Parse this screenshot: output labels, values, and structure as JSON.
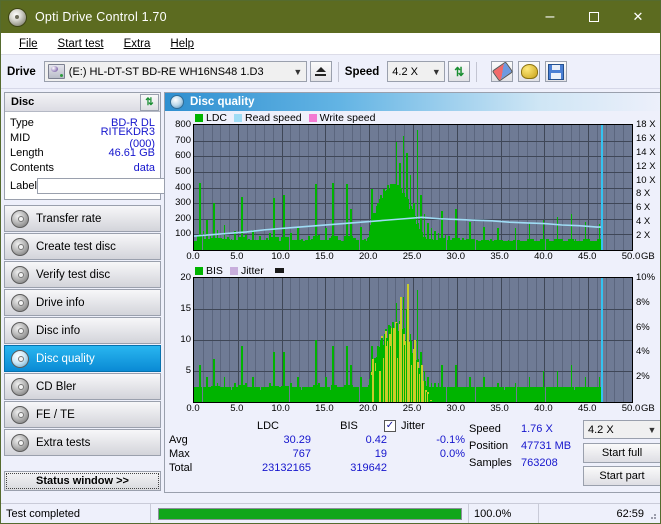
{
  "window": {
    "title": "Opti Drive Control 1.70",
    "icon": "disc-icon",
    "minimize": "–",
    "maximize": "square",
    "close": "✕"
  },
  "menu": [
    "File",
    "Start test",
    "Extra",
    "Help"
  ],
  "toolbar": {
    "drive_label": "Drive",
    "drive_value": "(E:)   HL-DT-ST BD-RE  WH16NS48 1.D3",
    "eject_title": "eject-button",
    "speed_label": "Speed",
    "speed_value": "4.2 X",
    "refresh_icon": "refresh-icon",
    "eraser_icon": "eraser-icon",
    "tools_icon": "tools-icon",
    "save_icon": "save-icon"
  },
  "disc": {
    "header": "Disc",
    "refresh_icon": "refresh-icon",
    "rows": [
      {
        "key": "Type",
        "value": "BD-R DL"
      },
      {
        "key": "MID",
        "value": "RITEKDR3 (000)"
      },
      {
        "key": "Length",
        "value": "46.61 GB"
      },
      {
        "key": "Contents",
        "value": "data"
      }
    ],
    "label_key": "Label",
    "label_value": "",
    "label_placeholder": ""
  },
  "nav": {
    "items": [
      {
        "label": "Transfer rate",
        "active": false
      },
      {
        "label": "Create test disc",
        "active": false
      },
      {
        "label": "Verify test disc",
        "active": false
      },
      {
        "label": "Drive info",
        "active": false
      },
      {
        "label": "Disc info",
        "active": false
      },
      {
        "label": "Disc quality",
        "active": true
      },
      {
        "label": "CD Bler",
        "active": false
      },
      {
        "label": "FE / TE",
        "active": false
      },
      {
        "label": "Extra tests",
        "active": false
      }
    ],
    "status_window": "Status window >>"
  },
  "main": {
    "title": "Disc quality",
    "icon": "disc-quality-icon"
  },
  "chart_data": [
    {
      "type": "bar",
      "name": "ldc-chart",
      "title": "Disc quality",
      "xlabel": "GB",
      "ylabel": "LDC",
      "xlim": [
        0,
        50
      ],
      "ylim": [
        0,
        800
      ],
      "xticks": [
        "0.0",
        "5.0",
        "10.0",
        "15.0",
        "20.0",
        "25.0",
        "30.0",
        "35.0",
        "40.0",
        "45.0",
        "50.0"
      ],
      "xunit": "GB",
      "yticks": [
        100,
        200,
        300,
        400,
        500,
        600,
        700,
        800
      ],
      "y2ticks": [
        "2 X",
        "4 X",
        "6 X",
        "8 X",
        "10 X",
        "12 X",
        "14 X",
        "16 X",
        "18 X"
      ],
      "y2lim": [
        0,
        18
      ],
      "grid": true,
      "legend": [
        {
          "label": "LDC",
          "color": "#00b400"
        },
        {
          "label": "Read speed",
          "color": "#9fdcf5"
        },
        {
          "label": "Write speed",
          "color": "#f37ad2"
        }
      ],
      "series": [
        {
          "name": "LDC",
          "color": "#00b400",
          "x": [
            0.3,
            0.7,
            1.1,
            1.5,
            1.9,
            2.3,
            2.7,
            3.1,
            3.5,
            3.9,
            4.3,
            4.7,
            5.1,
            5.5,
            5.9,
            6.3,
            6.7,
            7.1,
            7.5,
            7.9,
            8.3,
            8.7,
            9.1,
            9.5,
            9.9,
            10.3,
            10.7,
            11.1,
            11.5,
            11.9,
            12.3,
            12.7,
            13.1,
            13.5,
            13.9,
            14.3,
            14.7,
            15.1,
            15.5,
            15.9,
            16.3,
            16.7,
            17.1,
            17.5,
            17.9,
            18.3,
            18.7,
            19.1,
            19.5,
            19.9,
            20.3,
            20.7,
            21.1,
            21.5,
            21.9,
            22.3,
            22.7,
            23.1,
            23.5,
            23.9,
            24.3,
            24.7,
            25.1,
            25.5,
            25.9,
            26.3,
            26.7,
            27.1,
            27.5,
            27.9,
            28.3,
            28.7,
            29.1,
            29.5,
            29.9,
            30.3,
            30.7,
            31.1,
            31.5,
            31.9,
            32.3,
            32.7,
            33.1,
            33.5,
            33.9,
            34.3,
            34.7,
            35.1,
            35.5,
            35.9,
            36.3,
            36.7,
            37.1,
            37.5,
            37.9,
            38.3,
            38.7,
            39.1,
            39.5,
            39.9,
            40.3,
            40.7,
            41.1,
            41.5,
            41.9,
            42.3,
            42.7,
            43.1,
            43.5,
            43.9,
            44.3,
            44.7,
            45.1,
            45.5,
            45.9,
            46.3,
            46.6
          ],
          "values": [
            60,
            430,
            120,
            190,
            90,
            300,
            130,
            75,
            160,
            85,
            70,
            120,
            60,
            340,
            95,
            70,
            130,
            55,
            90,
            60,
            75,
            110,
            330,
            70,
            60,
            350,
            80,
            110,
            60,
            140,
            70,
            60,
            90,
            70,
            420,
            95,
            60,
            140,
            75,
            430,
            90,
            65,
            60,
            420,
            260,
            80,
            60,
            150,
            70,
            60,
            390,
            240,
            170,
            330,
            260,
            370,
            420,
            690,
            560,
            730,
            620,
            480,
            300,
            770,
            350,
            230,
            170,
            140,
            120,
            110,
            250,
            95,
            90,
            80,
            260,
            80,
            75,
            70,
            180,
            70,
            65,
            60,
            150,
            60,
            70,
            65,
            140,
            60,
            60,
            65,
            55,
            140,
            60,
            60,
            55,
            170,
            60,
            60,
            55,
            190,
            60,
            55,
            60,
            210,
            60,
            55,
            60,
            230,
            55,
            50,
            60,
            180,
            55,
            50,
            60,
            165,
            60
          ]
        },
        {
          "name": "Read speed",
          "color": "#9fdcf5",
          "x": [
            0,
            2,
            4,
            6,
            8,
            10,
            12,
            14,
            16,
            18,
            20,
            22,
            24,
            26,
            28,
            30,
            32,
            34,
            36,
            38,
            40,
            42,
            44,
            46,
            46.6
          ],
          "values": [
            2.0,
            2.2,
            2.4,
            2.6,
            2.9,
            3.1,
            3.3,
            3.5,
            3.7,
            3.9,
            4.1,
            4.3,
            4.5,
            4.7,
            4.5,
            4.4,
            4.3,
            4.2,
            4.0,
            3.9,
            3.8,
            3.6,
            3.5,
            3.3,
            3.3
          ]
        }
      ],
      "cursor_line_x": 46.5,
      "cursor_color": "#34c3f0"
    },
    {
      "type": "bar",
      "name": "bis-chart",
      "xlabel": "GB",
      "ylabel": "BIS",
      "xlim": [
        0,
        50
      ],
      "ylim": [
        0,
        20
      ],
      "xticks": [
        "0.0",
        "5.0",
        "10.0",
        "15.0",
        "20.0",
        "25.0",
        "30.0",
        "35.0",
        "40.0",
        "45.0",
        "50.0"
      ],
      "xunit": "GB",
      "yticks": [
        5,
        10,
        15,
        20
      ],
      "y2ticks": [
        "2%",
        "4%",
        "6%",
        "8%",
        "10%"
      ],
      "y2lim": [
        0,
        10
      ],
      "grid": true,
      "legend": [
        {
          "label": "BIS",
          "color": "#00b400"
        },
        {
          "label": "Jitter",
          "color": "#c8aedc"
        }
      ],
      "series": [
        {
          "name": "BIS",
          "color": "#00b400",
          "x": [
            0.3,
            0.7,
            1.1,
            1.5,
            1.9,
            2.3,
            2.7,
            3.1,
            3.5,
            3.9,
            4.3,
            4.7,
            5.1,
            5.5,
            5.9,
            6.3,
            6.7,
            7.1,
            7.5,
            7.9,
            8.3,
            8.7,
            9.1,
            9.5,
            9.9,
            10.3,
            10.7,
            11.1,
            11.5,
            11.9,
            12.3,
            12.7,
            13.1,
            13.5,
            13.9,
            14.3,
            14.7,
            15.1,
            15.5,
            15.9,
            16.3,
            16.7,
            17.1,
            17.5,
            17.9,
            18.3,
            18.7,
            19.1,
            19.5,
            19.9,
            20.3,
            20.7,
            21.1,
            21.5,
            21.9,
            22.3,
            22.7,
            23.1,
            23.5,
            23.9,
            24.3,
            24.7,
            25.1,
            25.5,
            25.9,
            26.3,
            26.7,
            27.1,
            27.5,
            27.9,
            28.3,
            28.7,
            29.1,
            29.5,
            29.9,
            30.3,
            30.7,
            31.1,
            31.5,
            31.9,
            32.3,
            32.7,
            33.1,
            33.5,
            33.9,
            34.3,
            34.7,
            35.1,
            35.5,
            35.9,
            36.3,
            36.7,
            37.1,
            37.5,
            37.9,
            38.3,
            38.7,
            39.1,
            39.5,
            39.9,
            40.3,
            40.7,
            41.1,
            41.5,
            41.9,
            42.3,
            42.7,
            43.1,
            43.5,
            43.9,
            44.3,
            44.7,
            45.1,
            45.5,
            45.9,
            46.3,
            46.6
          ],
          "values": [
            2,
            6,
            2,
            4,
            2,
            7,
            3,
            2,
            4,
            2,
            2,
            3,
            2,
            9,
            3,
            2,
            4,
            2,
            2,
            2,
            2,
            3,
            8,
            2,
            2,
            8,
            2,
            3,
            2,
            4,
            2,
            2,
            2,
            2,
            10,
            3,
            2,
            4,
            2,
            9,
            2,
            2,
            2,
            9,
            6,
            2,
            2,
            4,
            2,
            2,
            9,
            6,
            4,
            8,
            6,
            9,
            10,
            16,
            13,
            17,
            15,
            11,
            7,
            18,
            8,
            5,
            4,
            3,
            3,
            3,
            6,
            2,
            2,
            2,
            6,
            2,
            2,
            2,
            4,
            2,
            2,
            2,
            4,
            2,
            2,
            2,
            3,
            2,
            2,
            2,
            2,
            3,
            2,
            2,
            2,
            4,
            2,
            2,
            2,
            5,
            2,
            2,
            2,
            5,
            2,
            2,
            2,
            6,
            2,
            2,
            2,
            4,
            2,
            2,
            2,
            4,
            2
          ]
        },
        {
          "name": "Jitter",
          "color": "#c8cc2a",
          "x": [
            20.3,
            21.1,
            21.9,
            22.7,
            23.5,
            24.3,
            25.1,
            25.9
          ],
          "values": [
            7,
            5,
            9,
            12,
            17,
            19,
            10,
            6
          ]
        }
      ],
      "cursor_line_x": 46.5,
      "cursor_color": "#34c3f0"
    }
  ],
  "stats": {
    "col_headers": [
      "LDC",
      "BIS"
    ],
    "jitter_label": "Jitter",
    "jitter_checked": true,
    "rows": [
      {
        "key": "Avg",
        "ldc": "30.29",
        "bis": "0.42",
        "jitter": "-0.1%"
      },
      {
        "key": "Max",
        "ldc": "767",
        "bis": "19",
        "jitter": "0.0%"
      },
      {
        "key": "Total",
        "ldc": "23132165",
        "bis": "319642",
        "jitter": ""
      }
    ]
  },
  "controls": {
    "speed_label": "Speed",
    "speed_value": "1.76 X",
    "speed_select": "4.2 X",
    "position_label": "Position",
    "position_value": "47731 MB",
    "samples_label": "Samples",
    "samples_value": "763208",
    "start_full": "Start full",
    "start_part": "Start part"
  },
  "statusbar": {
    "message": "Test completed",
    "progress_percent": 100.0,
    "progress_text": "100.0%",
    "elapsed": "62:59"
  }
}
